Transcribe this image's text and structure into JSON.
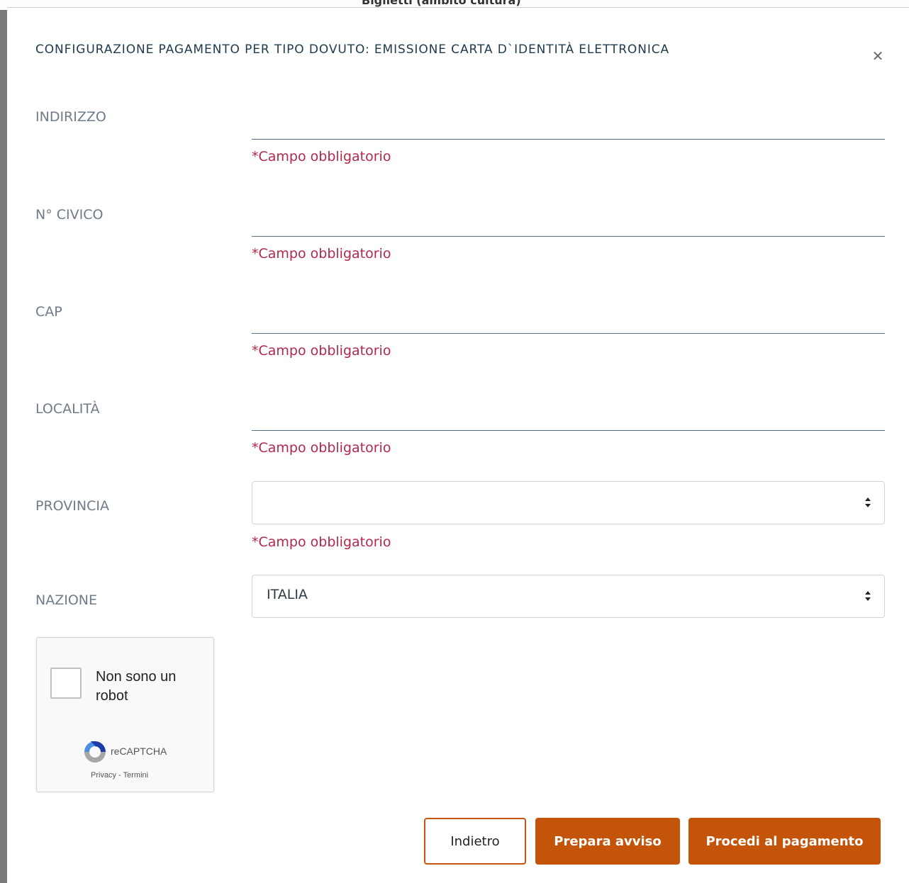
{
  "background_page": {
    "heading_fragment": "Biglietti (ambito cultura)"
  },
  "modal": {
    "title": "CONFIGURAZIONE PAGAMENTO PER TIPO DOVUTO: EMISSIONE CARTA D`IDENTITÀ ELETTRONICA",
    "close_icon": "close-icon",
    "fields": {
      "indirizzo": {
        "label": "INDIRIZZO",
        "value": "",
        "error": "*Campo obbligatorio"
      },
      "civico": {
        "label": "N° CIVICO",
        "value": "",
        "error": "*Campo obbligatorio"
      },
      "cap": {
        "label": "CAP",
        "value": "",
        "error": "*Campo obbligatorio"
      },
      "localita": {
        "label": "LOCALITÀ",
        "value": "",
        "error": "*Campo obbligatorio"
      },
      "provincia": {
        "label": "PROVINCIA",
        "selected": "",
        "error": "*Campo obbligatorio"
      },
      "nazione": {
        "label": "NAZIONE",
        "selected": "ITALIA"
      }
    },
    "captcha": {
      "label": "Non sono un robot",
      "brand": "reCAPTCHA",
      "privacy": "Privacy",
      "separator": " - ",
      "terms": "Termini"
    },
    "buttons": {
      "back": "Indietro",
      "prepare": "Prepara avviso",
      "proceed": "Procedi al pagamento"
    },
    "colors": {
      "accent": "#c4540a",
      "error": "#b3284a",
      "title": "#1e3a4c"
    }
  }
}
